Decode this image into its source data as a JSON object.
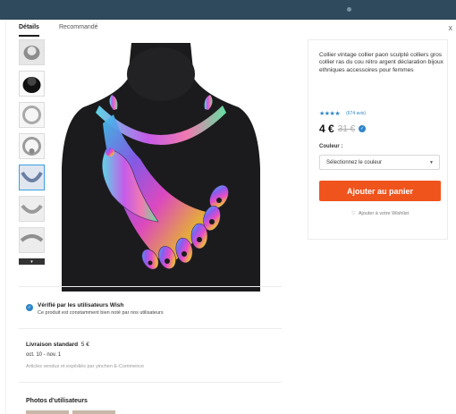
{
  "tabs": [
    {
      "label": "Détails",
      "active": true
    },
    {
      "label": "Recommandé",
      "active": false
    }
  ],
  "close_label": "x",
  "thumbnails": [
    {
      "name": "thumbnail-1-necklace-gray",
      "color": "#9a9a9a"
    },
    {
      "name": "thumbnail-2-necklace-black",
      "color": "#1a1a1a"
    },
    {
      "name": "thumbnail-3-necklace-silver",
      "color": "#c8c8c8"
    },
    {
      "name": "thumbnail-4-necklace-silver",
      "color": "#bdbdbd"
    },
    {
      "name": "thumbnail-5-necklace-detail",
      "color": "#8a9bb5"
    },
    {
      "name": "thumbnail-6-necklace-detail",
      "color": "#b0b0b0"
    },
    {
      "name": "thumbnail-7-necklace-detail",
      "color": "#a8a8a8"
    }
  ],
  "product": {
    "title": "Collier vintage collier paon sculpté colliers gros collier ras du cou rétro argent déclaration bijoux ethniques accessoires pour femmes",
    "stars": "★★★★",
    "rating_count": "(674 avis)",
    "price": "4 €",
    "old_price": "31 €",
    "color_label": "Couleur :",
    "select_placeholder": "Sélectionnez le couleur",
    "add_to_cart": "Ajouter au panier",
    "wishlist": "Ajouter à votre Wishlist"
  },
  "verified": {
    "title": "Vérifié par les utilisateurs Wish",
    "subtitle": "Ce produit est constamment bien noté par nos utilisateurs"
  },
  "shipping": {
    "title": "Livraison standard",
    "price": "5 €",
    "dates": "oct. 10 - nov. 1",
    "seller": "Articles vendus et expédiés par yinchen E-Commence"
  },
  "photos_title": "Photos d'utilisateurs",
  "colors": {
    "accent": "#f0541d",
    "link": "#2f86c8",
    "header": "#2f4a5c"
  }
}
